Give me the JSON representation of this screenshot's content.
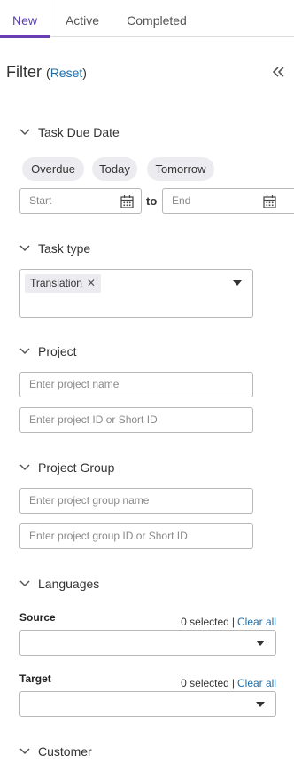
{
  "tabs": [
    {
      "label": "New",
      "active": true
    },
    {
      "label": "Active",
      "active": false
    },
    {
      "label": "Completed",
      "active": false
    }
  ],
  "filter": {
    "title": "Filter",
    "reset_label": "Reset",
    "collapse_icon": "double-chevron-left-icon"
  },
  "sections": {
    "due_date": {
      "label": "Task Due Date",
      "quick_chips": [
        "Overdue",
        "Today",
        "Tomorrow"
      ],
      "start_placeholder": "Start",
      "to_label": "to",
      "end_placeholder": "End"
    },
    "task_type": {
      "label": "Task type",
      "selected": [
        "Translation"
      ]
    },
    "project": {
      "label": "Project",
      "name_placeholder": "Enter project name",
      "id_placeholder": "Enter project ID or Short ID"
    },
    "project_group": {
      "label": "Project Group",
      "name_placeholder": "Enter project group name",
      "id_placeholder": "Enter project group ID or Short ID"
    },
    "languages": {
      "label": "Languages",
      "source": {
        "label": "Source",
        "selected_count": "0 selected",
        "clear_label": "Clear all"
      },
      "target": {
        "label": "Target",
        "selected_count": "0 selected",
        "clear_label": "Clear all"
      }
    },
    "customer": {
      "label": "Customer"
    }
  },
  "colors": {
    "accent": "#6a3fb5",
    "link": "#1f6ea8",
    "chip_bg": "#ececf0",
    "border": "#b8b8b8"
  }
}
